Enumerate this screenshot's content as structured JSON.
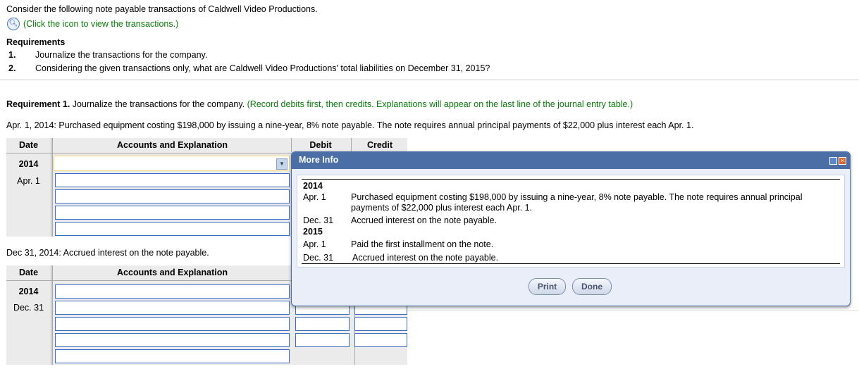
{
  "intro": "Consider the following note payable transactions of Caldwell Video Productions.",
  "view_link": "(Click the icon to view the transactions.)",
  "requirements": {
    "title": "Requirements",
    "items": [
      {
        "num": "1.",
        "text": "Journalize the transactions for the company."
      },
      {
        "num": "2.",
        "text": "Considering the given transactions only, what are Caldwell Video Productions' total liabilities on December 31, 2015?"
      }
    ]
  },
  "req1": {
    "label": "Requirement 1.",
    "text": " Journalize the transactions for the company.",
    "hint": "(Record debits first, then credits. Explanations will appear on the last line of the journal entry table.)"
  },
  "entry1": {
    "prompt": "Apr. 1, 2014: Purchased equipment costing $198,000 by issuing a nine-year, 8% note payable. The note requires annual principal payments of $22,000 plus interest each Apr. 1.",
    "year": "2014",
    "date": "Apr. 1"
  },
  "entry2": {
    "prompt": "Dec 31, 2014: Accrued interest on the note payable.",
    "year": "2014",
    "date": "Dec. 31"
  },
  "table_headers": {
    "date": "Date",
    "accounts": "Accounts and Explanation",
    "debit": "Debit",
    "credit": "Credit"
  },
  "modal": {
    "title": "More Info",
    "y2014": "2014",
    "y2015": "2015",
    "rows": [
      {
        "date": "Apr. 1",
        "desc": "Purchased equipment costing $198,000 by issuing a nine-year, 8% note payable. The note requires annual principal payments of $22,000 plus interest each Apr. 1."
      },
      {
        "date": "Dec. 31",
        "desc": "Accrued interest on the note payable."
      },
      {
        "date": "Apr. 1",
        "desc": "Paid the first installment on the note."
      },
      {
        "date": "Dec. 31",
        "desc": "Accrued interest on the note payable."
      }
    ],
    "print": "Print",
    "done": "Done"
  }
}
